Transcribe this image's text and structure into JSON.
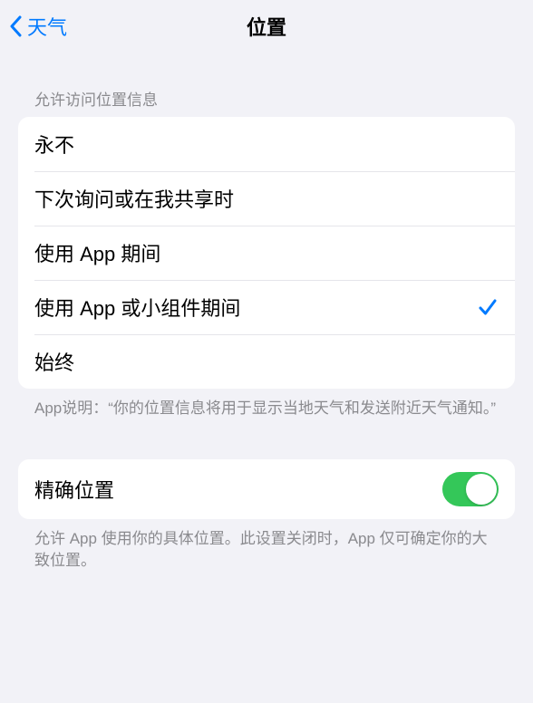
{
  "nav": {
    "back_label": "天气",
    "title": "位置"
  },
  "section1": {
    "header": "允许访问位置信息",
    "options": [
      {
        "label": "永不",
        "selected": false
      },
      {
        "label": "下次询问或在我共享时",
        "selected": false
      },
      {
        "label": "使用 App 期间",
        "selected": false
      },
      {
        "label": "使用 App 或小组件期间",
        "selected": true
      },
      {
        "label": "始终",
        "selected": false
      }
    ],
    "footer": "App说明：“你的位置信息将用于显示当地天气和发送附近天气通知。”"
  },
  "section2": {
    "precise_label": "精确位置",
    "precise_on": true,
    "footer": "允许 App 使用你的具体位置。此设置关闭时，App 仅可确定你的大致位置。"
  }
}
